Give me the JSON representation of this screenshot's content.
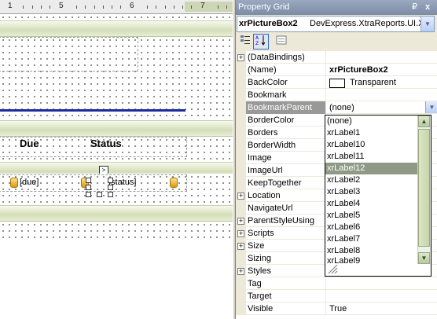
{
  "designer": {
    "ruler_numbers": [
      "1",
      "5",
      "6",
      "7"
    ],
    "header_due": "Due",
    "header_status": "Status",
    "field_due": "[due]",
    "field_status": "[status]",
    "smart_tag": ">"
  },
  "property_grid": {
    "title": "Property Grid",
    "pin_glyph": "₽",
    "close_glyph": "x",
    "selected_object_name": "xrPictureBox2",
    "selected_object_type": "DevExpress.XtraReports.UI.XRPictureBox",
    "toolbar": {
      "categorized_icon": "categorized-icon",
      "alphabetical_icon": "alphabetical-icon",
      "pages_icon": "property-pages-icon"
    },
    "rows": [
      {
        "name": "(DataBindings)",
        "value": "",
        "expandable": true
      },
      {
        "name": "(Name)",
        "value": "xrPictureBox2",
        "bold": true
      },
      {
        "name": "BackColor",
        "value": "Transparent",
        "swatch": "#ffffff"
      },
      {
        "name": "Bookmark",
        "value": ""
      },
      {
        "name": "BookmarkParent",
        "value": "(none)",
        "selected": true
      },
      {
        "name": "BorderColor",
        "value": ""
      },
      {
        "name": "Borders",
        "value": ""
      },
      {
        "name": "BorderWidth",
        "value": ""
      },
      {
        "name": "Image",
        "value": ""
      },
      {
        "name": "ImageUrl",
        "value": ""
      },
      {
        "name": "KeepTogether",
        "value": ""
      },
      {
        "name": "Location",
        "value": "",
        "expandable": true
      },
      {
        "name": "NavigateUrl",
        "value": ""
      },
      {
        "name": "ParentStyleUsing",
        "value": "",
        "expandable": true
      },
      {
        "name": "Scripts",
        "value": "",
        "expandable": true
      },
      {
        "name": "Size",
        "value": "",
        "expandable": true
      },
      {
        "name": "Sizing",
        "value": ""
      },
      {
        "name": "Styles",
        "value": "",
        "expandable": true
      },
      {
        "name": "Tag",
        "value": ""
      },
      {
        "name": "Target",
        "value": ""
      },
      {
        "name": "Visible",
        "value": "True"
      }
    ],
    "dropdown_options": [
      "(none)",
      "xrLabel1",
      "xrLabel10",
      "xrLabel11",
      "xrLabel12",
      "xrLabel2",
      "xrLabel3",
      "xrLabel4",
      "xrLabel5",
      "xrLabel6",
      "xrLabel7",
      "xrLabel8",
      "xrLabel9"
    ],
    "dropdown_highlighted": "xrLabel12"
  },
  "colors": {
    "band_accent": "#d4ddb8",
    "blue_line": "#1b2d9c",
    "selection": "#8e9a85"
  }
}
